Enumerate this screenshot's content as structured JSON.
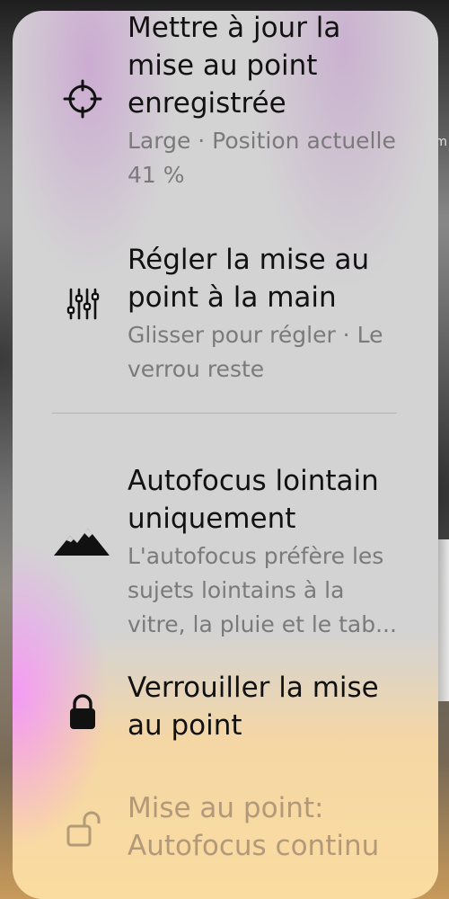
{
  "background": {
    "edge_text": "m"
  },
  "menu": {
    "items": [
      {
        "title": "Mettre à jour la mise au point enregistrée",
        "subtitle": "Large · Position actuelle 41 %",
        "icon": "crosshair-icon"
      },
      {
        "title": "Régler la mise au point à la main",
        "subtitle": "Glisser pour régler · Le verrou reste",
        "icon": "sliders-icon"
      },
      {
        "title": "Autofocus lointain uniquement",
        "subtitle": "L'autofocus préfère les sujets lointains à la vitre, la pluie et le tab...",
        "icon": "mountains-icon"
      },
      {
        "title": "Verrouiller la mise au point",
        "subtitle": "",
        "icon": "lock-icon"
      },
      {
        "title": "Mise au point: Autofocus continu",
        "subtitle": "",
        "icon": "unlock-icon"
      }
    ]
  }
}
